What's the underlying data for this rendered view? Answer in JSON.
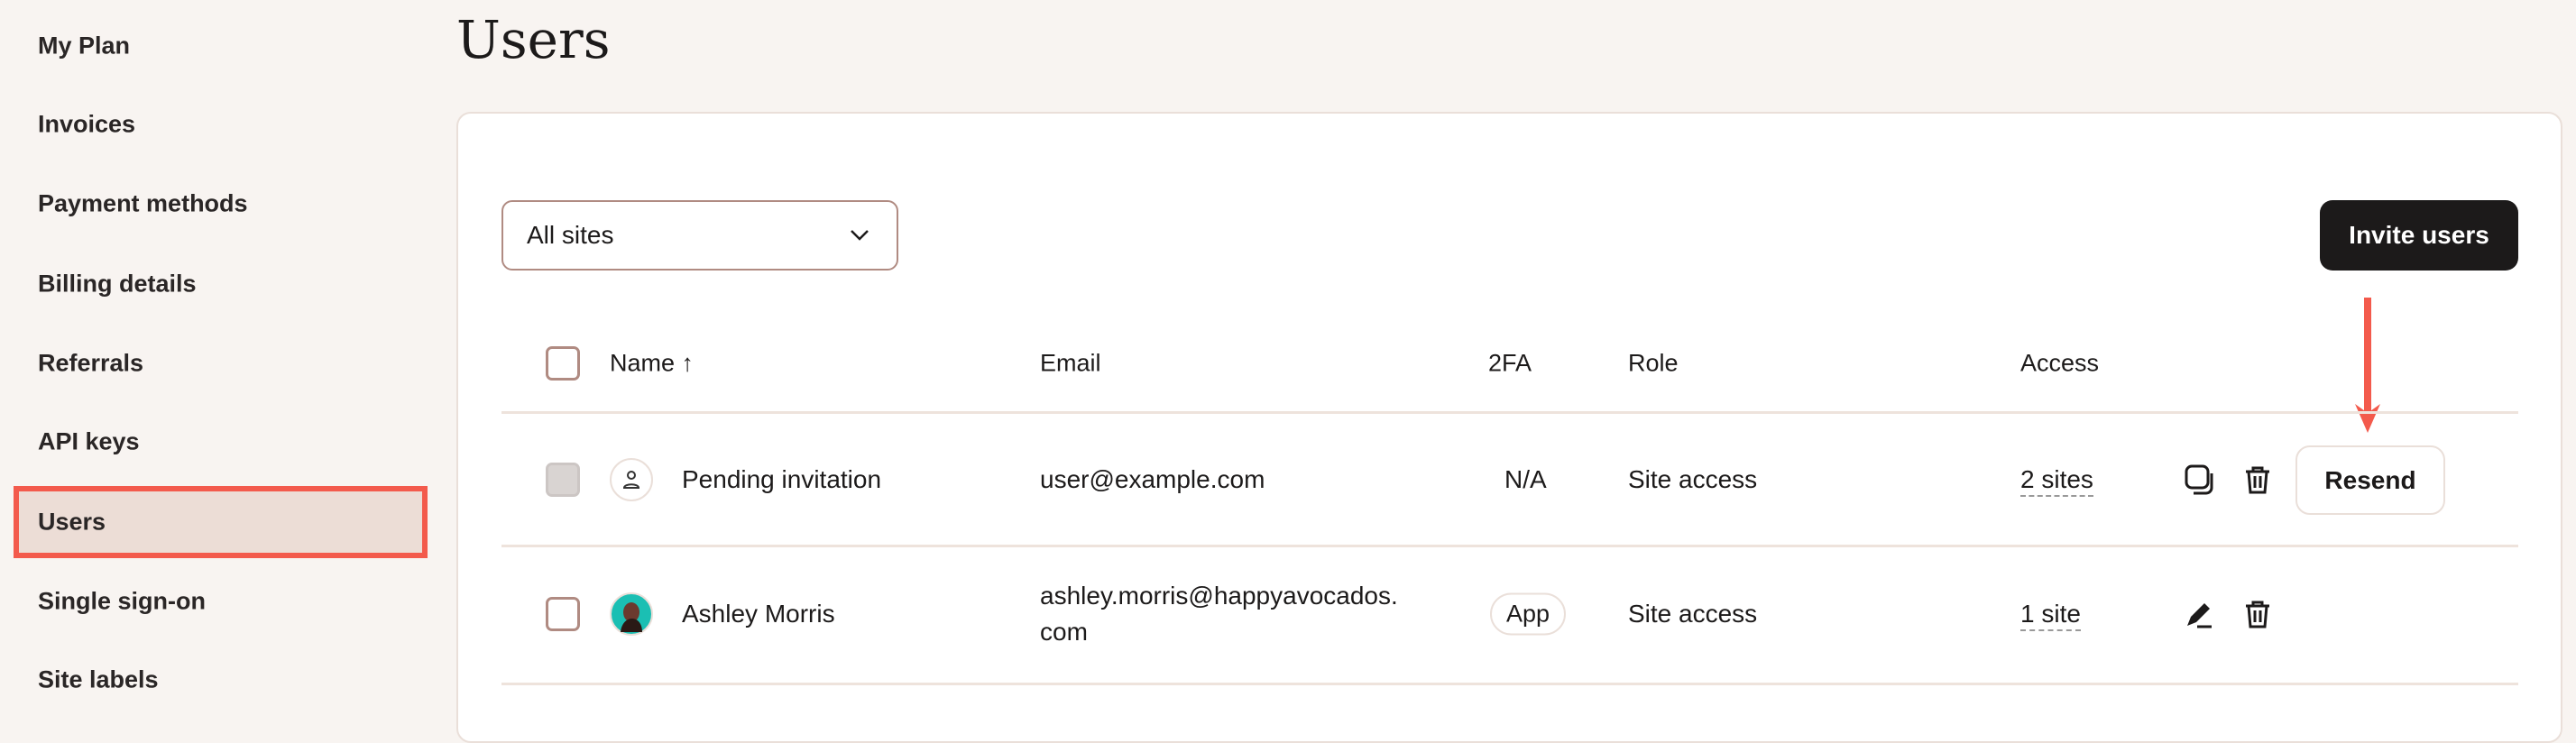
{
  "sidebar": {
    "items": [
      "My Plan",
      "Invoices",
      "Payment methods",
      "Billing details",
      "Referrals",
      "API keys",
      "Users",
      "Single sign-on",
      "Site labels"
    ],
    "active": "Users"
  },
  "page": {
    "title": "Users"
  },
  "toolbar": {
    "site_filter": "All sites",
    "invite_label": "Invite users"
  },
  "table": {
    "headers": {
      "name": "Name",
      "sort": "↑",
      "email": "Email",
      "twofa": "2FA",
      "role": "Role",
      "access": "Access"
    },
    "rows": [
      {
        "name": "Pending invitation",
        "email": "user@example.com",
        "twofa": "N/A",
        "role": "Site access",
        "access": "2 sites",
        "action": "Resend"
      },
      {
        "name": "Ashley Morris",
        "email_line1": "ashley.morris@happyavocados.",
        "email_line2": "com",
        "twofa": "App",
        "role": "Site access",
        "access": "1 site"
      }
    ]
  },
  "colors": {
    "accent": "#f35a4c",
    "button": "#1c1a1a"
  }
}
